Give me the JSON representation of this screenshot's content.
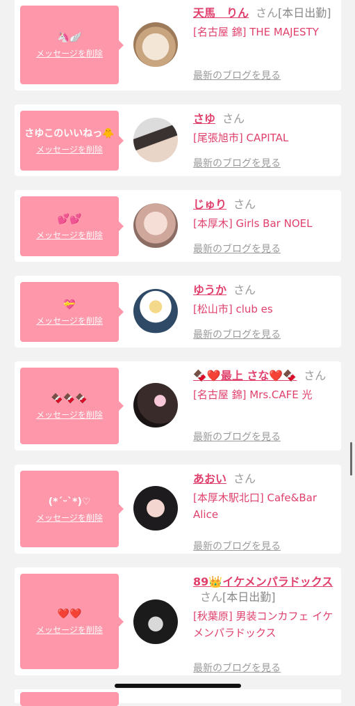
{
  "delete_label": "メッセージを削除",
  "blog_label": "最新のブログを見る",
  "san": "さん",
  "entries": [
    {
      "message": "🦄🪽",
      "name": "天馬　りん",
      "suffix": "[本日出勤]",
      "shop": "[名古屋 錦] THE MAJESTY"
    },
    {
      "message": "さゆこのいいねっ🐥",
      "name": "さゆ",
      "suffix": "",
      "shop": "[尾張旭市] CAPITAL"
    },
    {
      "message": "💕💕",
      "name": "じゅり",
      "suffix": "",
      "shop": "[本厚木] Girls Bar NOEL"
    },
    {
      "message": "💝",
      "name": "ゆうか",
      "suffix": "",
      "shop": "[松山市] club es"
    },
    {
      "message": "🍫🍫🍫",
      "name": "🍫❤️最上 さな❤️🍫",
      "suffix": "",
      "shop": "[名古屋 錦] Mrs.CAFE 光"
    },
    {
      "message": "(*ˊᵕˋ*)♡",
      "name": "あおい",
      "suffix": "",
      "shop": "[本厚木駅北口] Cafe&Bar Alice"
    },
    {
      "message": "❤️❤️",
      "name": "89👑イケメンパラドックス",
      "suffix": "[本日出勤]",
      "shop": "[秋葉原] 男装コンカフェ イケメンパラドックス"
    }
  ],
  "colors": {
    "accent": "#e0406c",
    "bubble": "#fd97a9"
  }
}
